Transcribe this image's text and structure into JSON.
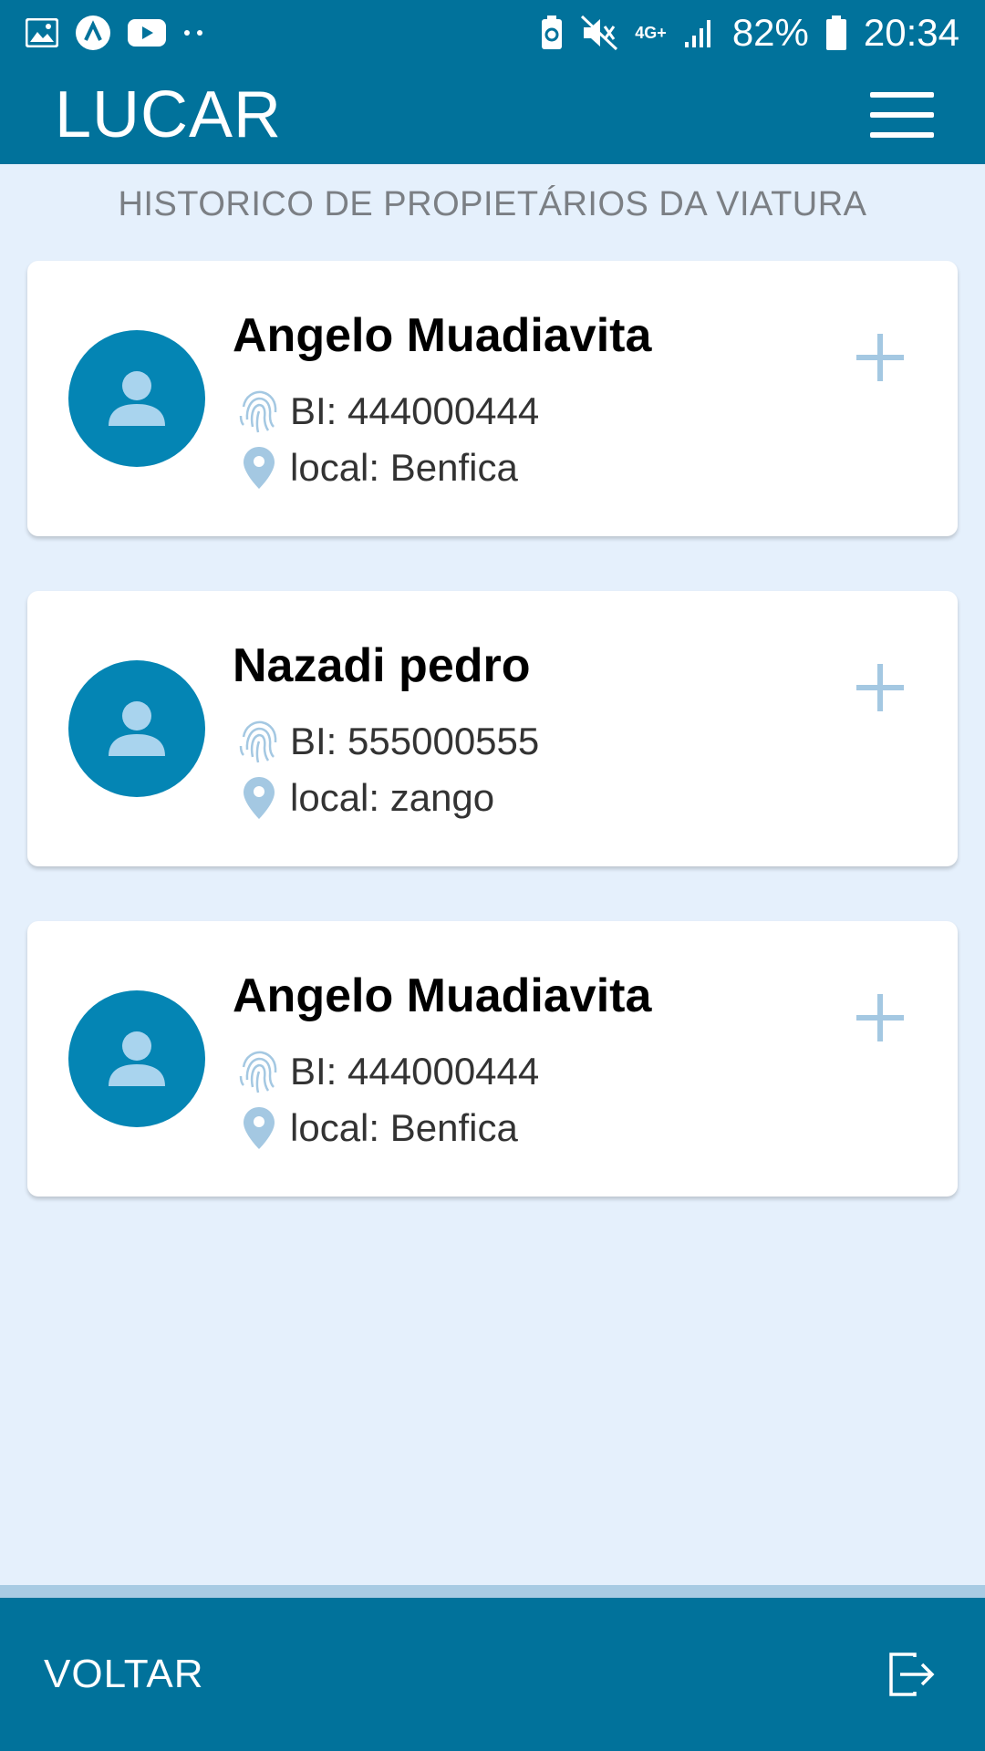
{
  "status_bar": {
    "left_icons": [
      "gallery-icon",
      "app-icon",
      "youtube-icon",
      "more-dots-icon"
    ],
    "right_icons": [
      "battery-saver-icon",
      "mute-icon",
      "network-4g-icon",
      "signal-icon",
      "battery-icon"
    ],
    "network_label": "4G+",
    "battery": "82%",
    "time": "20:34"
  },
  "header": {
    "title": "LUCAR",
    "menu_icon": "hamburger-menu-icon"
  },
  "page": {
    "title": "HISTORICO DE PROPIETÁRIOS DA VIATURA"
  },
  "owners": [
    {
      "name": "Angelo Muadiavita",
      "bi": "BI: 444000444",
      "local": "local: Benfica"
    },
    {
      "name": "Nazadi pedro",
      "bi": "BI: 555000555",
      "local": "local: zango"
    },
    {
      "name": "Angelo Muadiavita",
      "bi": "BI: 444000444",
      "local": "local: Benfica"
    }
  ],
  "footer": {
    "back_label": "VOLTAR",
    "exit_icon": "logout-icon"
  },
  "colors": {
    "primary": "#01729b",
    "avatar": "#0485b4",
    "background": "#e5f0fc",
    "accent_light": "#a8cbe3"
  }
}
